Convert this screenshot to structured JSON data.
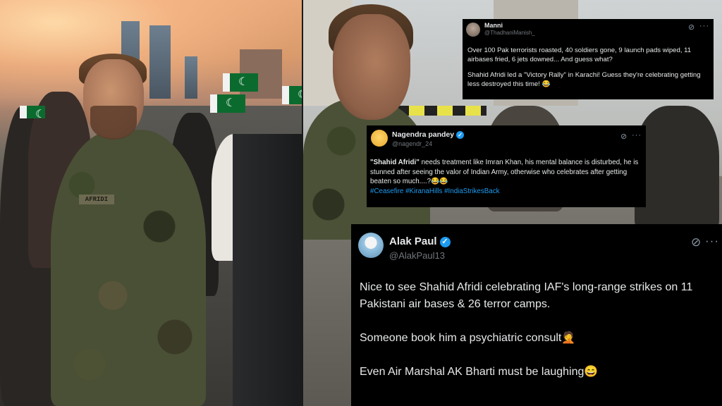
{
  "left_photo": {
    "nametag": "AFRIDI"
  },
  "tweets": [
    {
      "name": "Manni",
      "handle": "@ThadhaniManish_",
      "verified": false,
      "paragraphs": [
        "Over 100 Pak terrorists roasted, 40 soldiers gone, 9 launch pads wiped, 11 airbases fried, 6 jets downed... And guess what?",
        "Shahid Afridi led a \"Victory Rally\" in Karachi! Guess they're celebrating getting less destroyed this time! 😂"
      ],
      "grok_icon": "grok-icon",
      "more_icon": "more-icon"
    },
    {
      "name": "Nagendra pandey",
      "handle": "@nagendr_24",
      "verified": true,
      "bold_lead": "\"Shahid Afridi\"",
      "text": " needs treatment like Imran Khan, his mental balance is disturbed, he is stunned after seeing the valor of Indian Army, otherwise who celebrates after getting beaten so much....?😂😂",
      "hashtags": "#Ceasefire #KiranaHills #IndiaStrikesBack",
      "grok_icon": "grok-icon",
      "more_icon": "more-icon"
    },
    {
      "name": "Alak Paul",
      "handle": "@AlakPaul13",
      "verified": true,
      "paragraphs": [
        "Nice to see Shahid Afridi celebrating IAF's long-range strikes on 11 Pakistani air bases & 26 terror camps.",
        "Someone book him a psychiatric consult🤦",
        "Even Air Marshal AK Bharti must be laughing😄"
      ],
      "grok_icon": "grok-icon",
      "more_icon": "more-icon"
    }
  ],
  "glyphs": {
    "grok": "⊘",
    "more": "···",
    "check": "✓"
  },
  "colors": {
    "card_bg": "#000000",
    "text": "#e7e9ea",
    "muted": "#71767b",
    "accent": "#1d9bf0"
  }
}
